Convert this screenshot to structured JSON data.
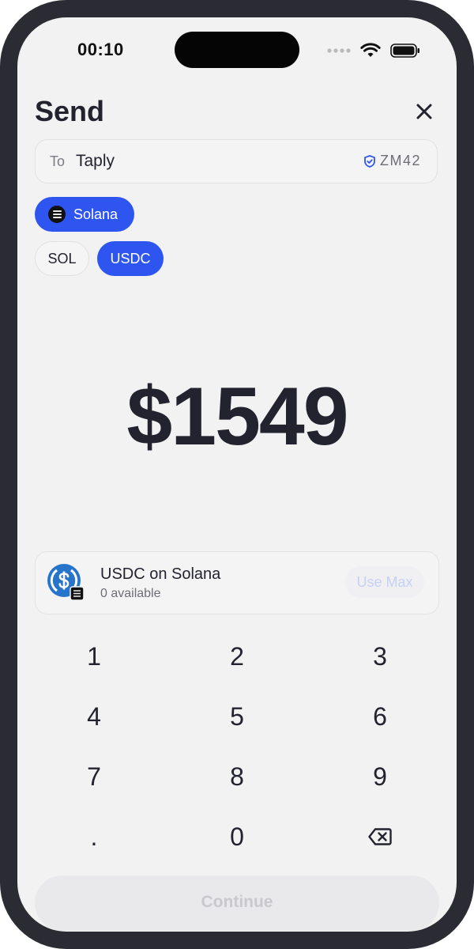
{
  "status_bar": {
    "time": "00:10"
  },
  "header": {
    "title": "Send"
  },
  "recipient": {
    "label": "To",
    "name": "Taply",
    "code": "ZM42"
  },
  "network": {
    "label": "Solana"
  },
  "tokens": [
    {
      "label": "SOL",
      "selected": false
    },
    {
      "label": "USDC",
      "selected": true
    }
  ],
  "amount": {
    "display": "$1549"
  },
  "asset": {
    "name": "USDC on Solana",
    "available": "0 available",
    "use_max_label": "Use Max"
  },
  "keypad": [
    "1",
    "2",
    "3",
    "4",
    "5",
    "6",
    "7",
    "8",
    "9",
    ".",
    "0",
    "backspace"
  ],
  "continue_label": "Continue",
  "colors": {
    "accent": "#2f55f0",
    "background": "#f2f2f2",
    "text": "#22232e",
    "usdc_blue": "#2775ca"
  },
  "icons": [
    "wifi-icon",
    "battery-icon",
    "cellular-icon",
    "close-icon",
    "shield-icon",
    "solana-icon",
    "usdc-icon",
    "backspace-icon"
  ]
}
